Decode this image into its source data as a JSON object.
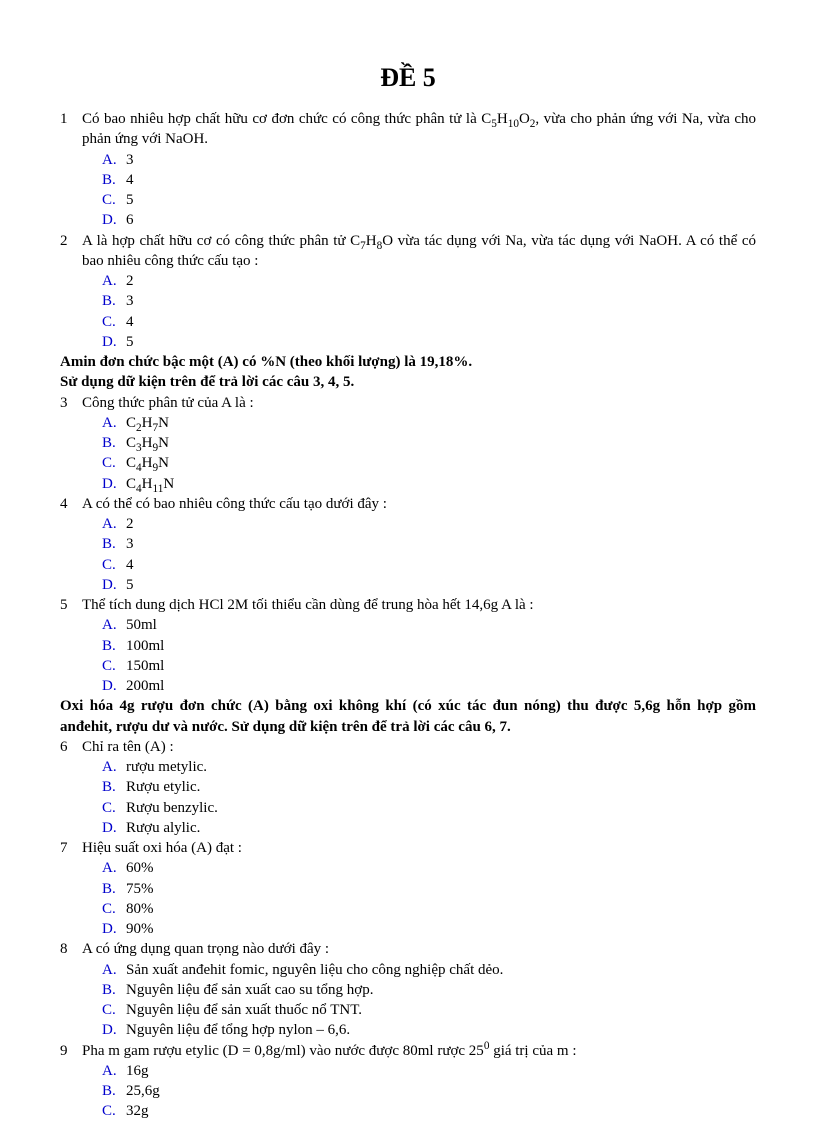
{
  "title": "ĐỀ 5",
  "questions": [
    {
      "num": "1",
      "text": "Có bao nhiêu hợp chất hữu cơ đơn chức có công thức phân tử là C<sub>5</sub>H<sub>10</sub>O<sub>2</sub>, vừa cho phản ứng với Na, vừa cho phản ứng với NaOH.",
      "opts": [
        "3",
        "4",
        "5",
        "6"
      ]
    },
    {
      "num": "2",
      "text": "A là hợp chất hữu cơ có công thức phân tử C<sub>7</sub>H<sub>8</sub>O vừa tác dụng với Na, vừa tác dụng với NaOH. A có thể có bao nhiêu công thức cấu tạo :",
      "opts": [
        "2",
        "3",
        "4",
        "5"
      ]
    }
  ],
  "passage1a": "Amin đơn chức bậc một (A) có %N (theo khối lượng) là 19,18%.",
  "passage1b": "Sử dụng dữ kiện trên để trả lời các câu 3, 4, 5.",
  "questions2": [
    {
      "num": "3",
      "text": "Công thức phân tử của A là :",
      "opts": [
        "C<sub>2</sub>H<sub>7</sub>N",
        "C<sub>3</sub>H<sub>9</sub>N",
        "C<sub>4</sub>H<sub>9</sub>N",
        "C<sub>4</sub>H<sub>11</sub>N"
      ]
    },
    {
      "num": "4",
      "text": "A có thể có bao nhiêu công thức cấu tạo dưới đây :",
      "opts": [
        "2",
        "3",
        "4",
        "5"
      ]
    },
    {
      "num": "5",
      "text": "Thể tích dung dịch HCl 2M tối thiểu cần dùng để trung hòa hết 14,6g A là :",
      "opts": [
        "50ml",
        "100ml",
        "150ml",
        "200ml"
      ]
    }
  ],
  "passage2": "Oxi hóa 4g rượu đơn chức (A) bằng oxi không khí (có xúc tác đun nóng) thu được 5,6g hỗn hợp gồm anđehit, rượu dư và nước. Sử dụng dữ kiện trên để trả lời các câu 6, 7.",
  "questions3": [
    {
      "num": "6",
      "text": "Chỉ ra tên (A) :",
      "opts": [
        "rượu metylic.",
        "Rượu etylic.",
        "Rượu benzylic.",
        "Rượu alylic."
      ]
    },
    {
      "num": "7",
      "text": "Hiệu suất oxi hóa (A) đạt :",
      "opts": [
        "60%",
        "75%",
        "80%",
        "90%"
      ]
    },
    {
      "num": "8",
      "text": "A có ứng dụng quan trọng nào dưới đây :",
      "opts": [
        "Sản xuất anđehit fomic, nguyên liệu cho công nghiệp chất dẻo.",
        "Nguyên liệu để sản xuất cao su tổng hợp.",
        "Nguyên liệu để sản xuất thuốc nổ TNT.",
        "Nguyên liệu để tổng hợp nylon – 6,6."
      ]
    },
    {
      "num": "9",
      "text": "Pha m gam rượu etylic (D = 0,8g/ml) vào nước được 80ml rược 25<sup>0</sup> giá trị của m :",
      "opts": [
        "16g",
        "25,6g",
        "32g"
      ]
    }
  ],
  "letters": [
    "A.",
    "B.",
    "C.",
    "D."
  ]
}
